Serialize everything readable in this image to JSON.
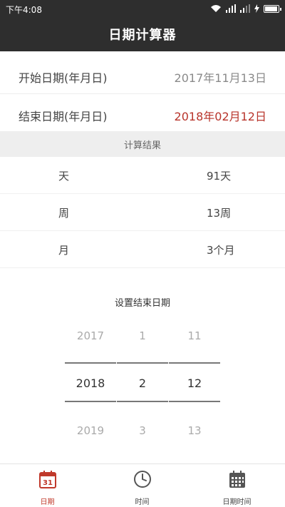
{
  "status_bar": {
    "time": "下午4:08"
  },
  "title_bar": {
    "title": "日期计算器"
  },
  "dates": {
    "start_label": "开始日期(年月日)",
    "start_value": "2017年11月13日",
    "end_label": "结束日期(年月日)",
    "end_value": "2018年02月12日"
  },
  "results": {
    "header": "计算结果",
    "rows": [
      {
        "unit": "天",
        "value": "91天"
      },
      {
        "unit": "周",
        "value": "13周"
      },
      {
        "unit": "月",
        "value": "3个月"
      }
    ]
  },
  "picker": {
    "title": "设置结束日期",
    "year": {
      "prev": "2017",
      "current": "2018",
      "next": "2019"
    },
    "month": {
      "prev": "1",
      "current": "2",
      "next": "3"
    },
    "day": {
      "prev": "11",
      "current": "12",
      "next": "13"
    }
  },
  "bottom_nav": {
    "date_label": "日期",
    "date_icon_text": "31",
    "time_label": "时间",
    "datetime_label": "日期时间",
    "active": "date"
  },
  "colors": {
    "header_bg": "#2e2e2e",
    "accent": "#c0392b",
    "end_date": "#b8342b",
    "muted": "#8a8a8a"
  }
}
